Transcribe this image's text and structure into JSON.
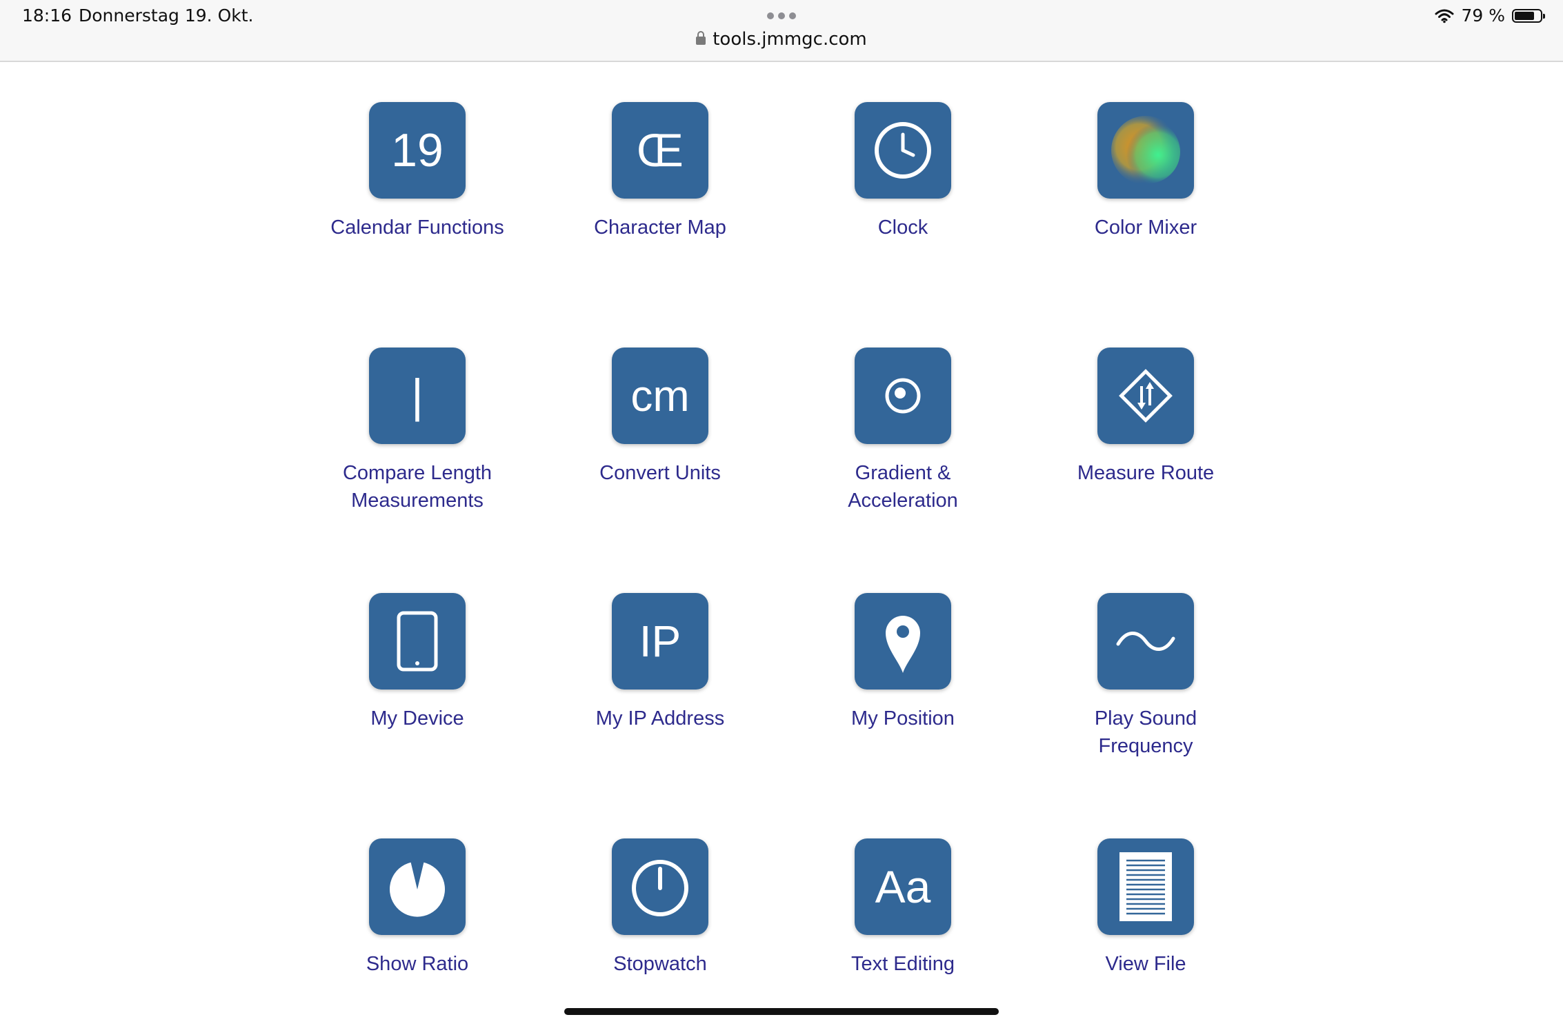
{
  "status_bar": {
    "time": "18:16",
    "date": "Donnerstag 19. Okt.",
    "battery": "79 %",
    "battery_level": 0.79
  },
  "browser": {
    "url": "tools.jmmgc.com"
  },
  "colors": {
    "tile": "#336699",
    "label": "#2d2a8c"
  },
  "tools": [
    {
      "label": "Calendar Functions",
      "glyph": "19",
      "icon": "calendar-icon"
    },
    {
      "label": "Character Map",
      "glyph": "Œ",
      "icon": "character-map-icon"
    },
    {
      "label": "Clock",
      "glyph": "",
      "icon": "clock-icon"
    },
    {
      "label": "Color Mixer",
      "glyph": "",
      "icon": "color-mixer-icon"
    },
    {
      "label": "Compare Length\nMeasurements",
      "glyph": "|",
      "icon": "length-bar-icon"
    },
    {
      "label": "Convert Units",
      "glyph": "cm",
      "icon": "units-icon"
    },
    {
      "label": "Gradient &\nAcceleration",
      "glyph": "",
      "icon": "gradient-icon"
    },
    {
      "label": "Measure Route",
      "glyph": "",
      "icon": "route-sign-icon"
    },
    {
      "label": "My Device",
      "glyph": "",
      "icon": "tablet-icon"
    },
    {
      "label": "My IP Address",
      "glyph": "IP",
      "icon": "ip-icon"
    },
    {
      "label": "My Position",
      "glyph": "",
      "icon": "location-pin-icon"
    },
    {
      "label": "Play Sound\nFrequency",
      "glyph": "",
      "icon": "sine-wave-icon"
    },
    {
      "label": "Show Ratio",
      "glyph": "",
      "icon": "pie-ratio-icon"
    },
    {
      "label": "Stopwatch",
      "glyph": "",
      "icon": "stopwatch-icon"
    },
    {
      "label": "Text Editing",
      "glyph": "Aa",
      "icon": "text-icon"
    },
    {
      "label": "View File",
      "glyph": "",
      "icon": "document-icon"
    }
  ]
}
